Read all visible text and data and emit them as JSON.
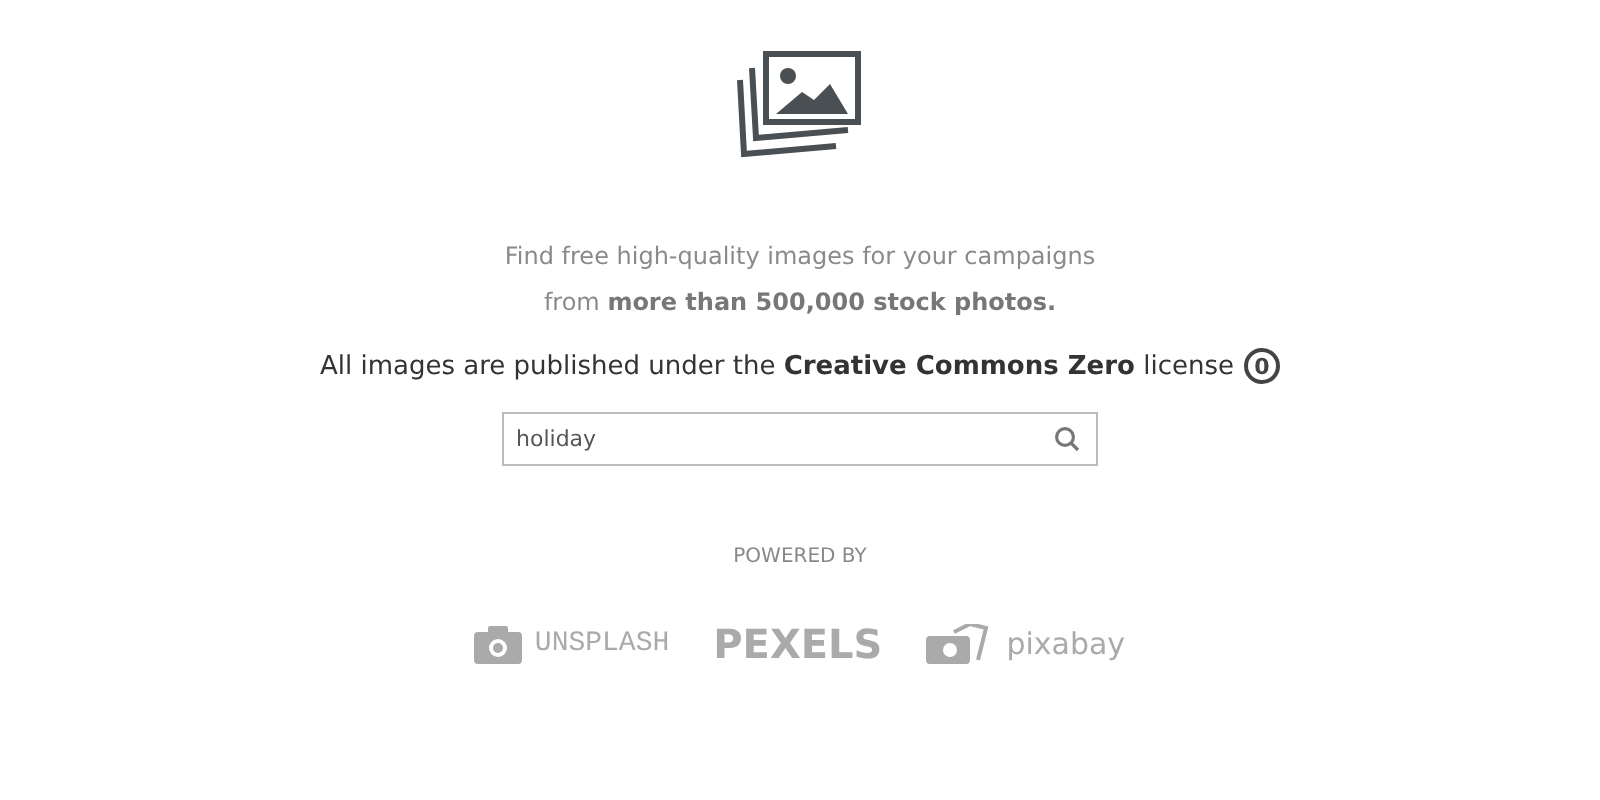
{
  "intro": [
    "Find free high-quality images for your campaigns",
    "from **more than 500,000 stock photos.**"
  ],
  "license": {
    "text": "All images are published under the **Creative Commons Zero** license",
    "badge": "0"
  },
  "search": {
    "value": "holiday"
  },
  "powered_by": "POWERED BY",
  "providers": [
    {
      "kind": "unsplash",
      "name": "UNSPLASH"
    },
    {
      "kind": "pexels",
      "name": "PEXELS"
    },
    {
      "kind": "pixabay",
      "name": "pixabay"
    }
  ]
}
